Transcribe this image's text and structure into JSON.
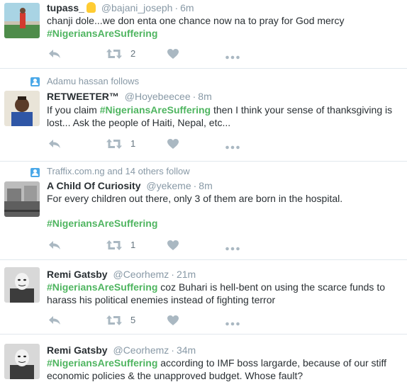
{
  "tweets": [
    {
      "name": "tupass_",
      "handle": "@bajani_joseph",
      "time": "6m",
      "line1": "chanji dole...we don enta one chance now na to pray for God mercy",
      "hashtag": "#NigeriansAreSuffering",
      "retweets": "2"
    },
    {
      "context": "Adamu hassan follows",
      "name": "RETWEETER™",
      "handle": "@Hoyebeecee",
      "time": "8m",
      "pre": "If you claim ",
      "hashtag": "#NigeriansAreSuffering",
      "post": " then I think your sense of thanksgiving is",
      "line2": "lost... Ask the people of Haiti, Nepal, etc...",
      "retweets": "1"
    },
    {
      "context": "Traffix.com.ng and 14 others follow",
      "name": "A Child Of Curiosity",
      "handle": "@yekeme",
      "time": "8m",
      "line1": "For every children out there, only 3 of them are born in the hospital.",
      "hashtag": "#NigeriansAreSuffering",
      "retweets": "1"
    },
    {
      "name": "Remi Gatsby",
      "handle": "@Ceorhemz",
      "time": "21m",
      "hashtag": "#NigeriansAreSuffering",
      "post": " coz Buhari is hell-bent on using the scarce funds to",
      "line2": "harass his political enemies instead of fighting terror",
      "retweets": "5"
    },
    {
      "name": "Remi Gatsby",
      "handle": "@Ceorhemz",
      "time": "34m",
      "hashtag": "#NigeriansAreSuffering",
      "post": " according to IMF boss largarde, because of our stiff",
      "line2": "economic policies & the unapproved budget. Whose fault?"
    }
  ],
  "colors": {
    "hashtag": "#4fb560",
    "meta": "#8899a6",
    "action": "#aab8c2",
    "context_icon": "#4aa8e8"
  },
  "icons": [
    "reply-icon",
    "retweet-icon",
    "like-icon",
    "more-icon",
    "follow-context-icon"
  ]
}
